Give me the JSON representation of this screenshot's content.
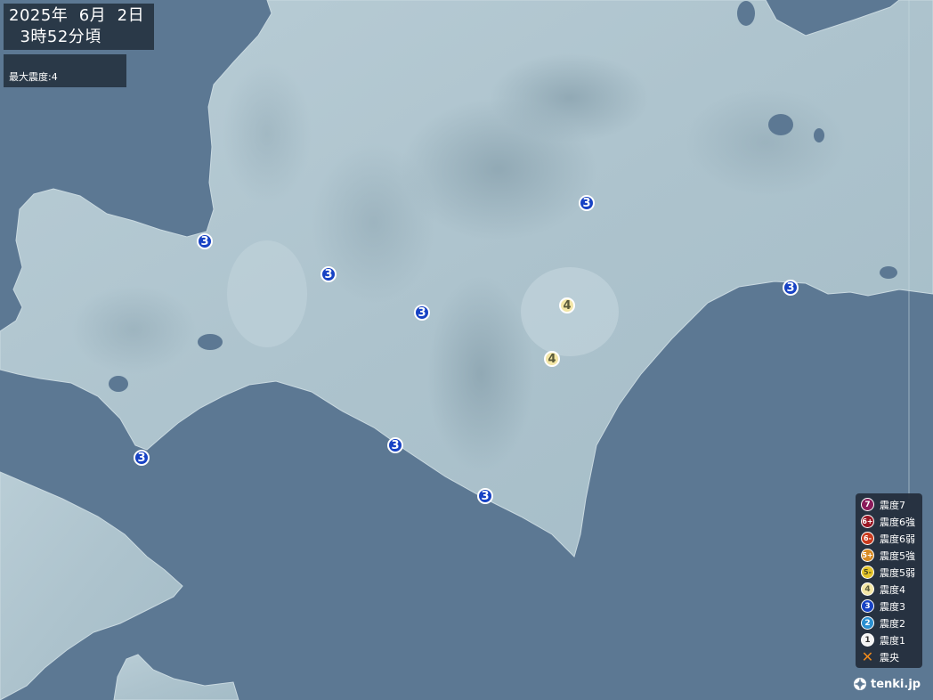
{
  "header": {
    "date": "2025年  6月  2日",
    "time": "  3時52分頃"
  },
  "summary": {
    "max_intensity": "最大震度:4"
  },
  "markers": [
    {
      "intensity": "3",
      "location": "west-coast"
    },
    {
      "intensity": "3",
      "location": "inland-west"
    },
    {
      "intensity": "3",
      "location": "inland-central"
    },
    {
      "intensity": "3",
      "location": "south-peninsula"
    },
    {
      "intensity": "3",
      "location": "south-coast-1"
    },
    {
      "intensity": "3",
      "location": "south-coast-2"
    },
    {
      "intensity": "3",
      "location": "north-inland"
    },
    {
      "intensity": "3",
      "location": "east-coast"
    },
    {
      "intensity": "4",
      "location": "tokachi-1"
    },
    {
      "intensity": "4",
      "location": "tokachi-2"
    }
  ],
  "legend": [
    {
      "label": "震度7",
      "symbol": "7",
      "color": "#8a1a5a"
    },
    {
      "label": "震度6強",
      "symbol": "6+",
      "color": "#9a1826"
    },
    {
      "label": "震度6弱",
      "symbol": "6-",
      "color": "#c83a1e"
    },
    {
      "label": "震度5強",
      "symbol": "5+",
      "color": "#d88a22"
    },
    {
      "label": "震度5弱",
      "symbol": "5-",
      "color": "#e5c42a"
    },
    {
      "label": "震度4",
      "symbol": "4",
      "color": "#f3e6a6"
    },
    {
      "label": "震度3",
      "symbol": "3",
      "color": "#1742c4"
    },
    {
      "label": "震度2",
      "symbol": "2",
      "color": "#2a8fd0"
    },
    {
      "label": "震度1",
      "symbol": "1",
      "color": "#f4f4f4"
    },
    {
      "label": "震央",
      "symbol": "✕",
      "color": "#f08a1c"
    }
  ],
  "brand": {
    "name": "tenki.jp"
  }
}
